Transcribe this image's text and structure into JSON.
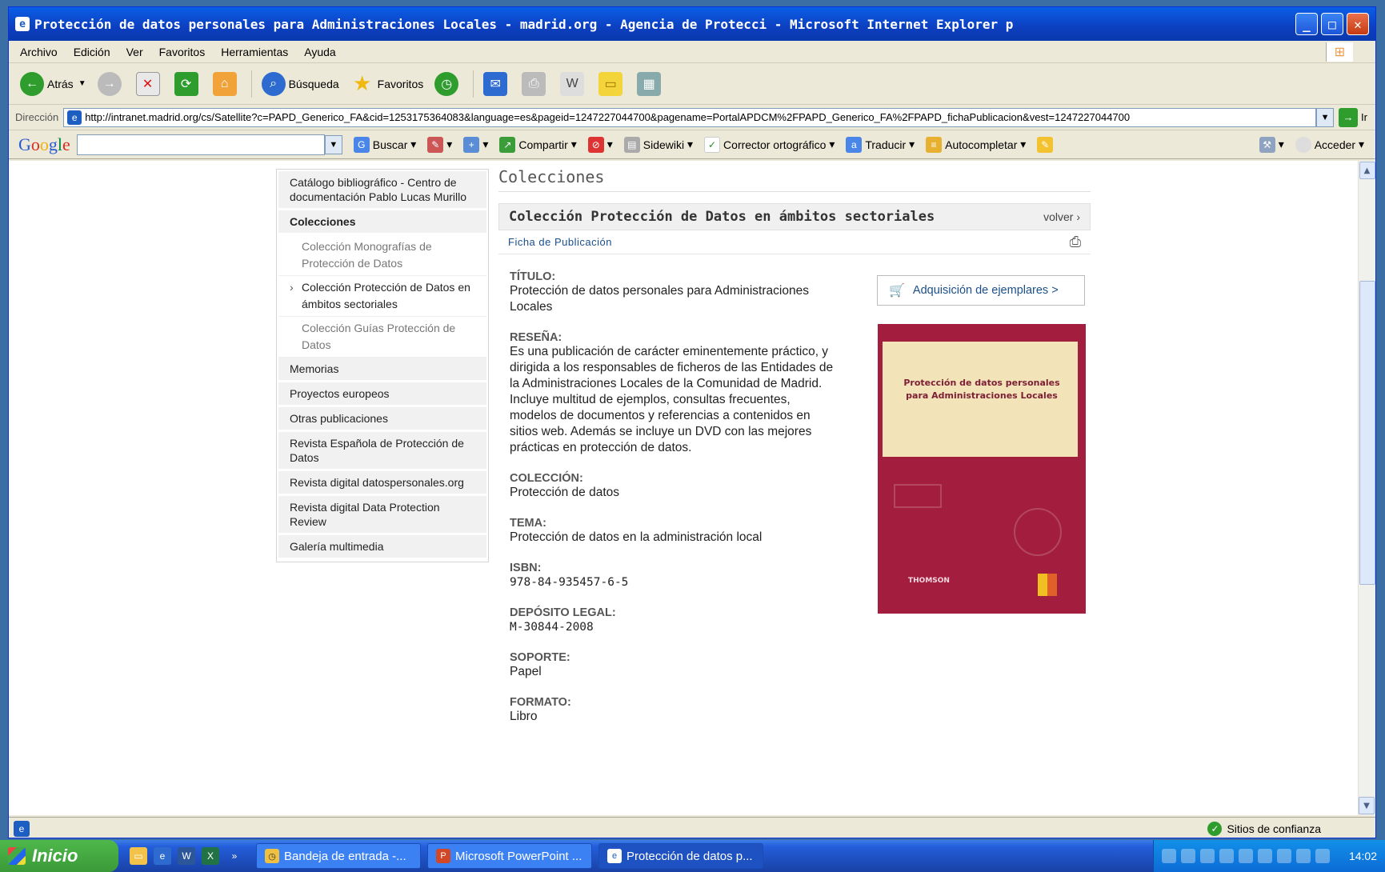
{
  "window": {
    "title": "Protección de datos personales para Administraciones Locales - madrid.org - Agencia de Protecci - Microsoft Internet Explorer p"
  },
  "menubar": [
    "Archivo",
    "Edición",
    "Ver",
    "Favoritos",
    "Herramientas",
    "Ayuda"
  ],
  "toolbar": {
    "back": "Atrás",
    "search": "Búsqueda",
    "favorites": "Favoritos"
  },
  "address": {
    "label": "Dirección",
    "url": "http://intranet.madrid.org/cs/Satellite?c=PAPD_Generico_FA&cid=1253175364083&language=es&pageid=1247227044700&pagename=PortalAPDCM%2FPAPD_Generico_FA%2FPAPD_fichaPublicacion&vest=1247227044700",
    "go": "Ir"
  },
  "googlebar": {
    "buscar": "Buscar",
    "compartir": "Compartir",
    "sidewiki": "Sidewiki",
    "corrector": "Corrector ortográfico",
    "traducir": "Traducir",
    "autocompletar": "Autocompletar",
    "acceder": "Acceder"
  },
  "sidebar": {
    "catalogo": "Catálogo bibliográfico - Centro de documentación Pablo Lucas Murillo",
    "colecciones": "Colecciones",
    "sub": [
      "Colección Monografías de Protección de Datos",
      "Colección Protección de Datos en ámbitos sectoriales",
      "Colección Guías Protección de Datos"
    ],
    "items": [
      "Memorias",
      "Proyectos europeos",
      "Otras publicaciones",
      "Revista Española de Protección de Datos",
      "Revista digital datospersonales.org",
      "Revista digital Data Protection Review",
      "Galería multimedia"
    ]
  },
  "main": {
    "page_title": "Colecciones",
    "collection": "Colección Protección de Datos en ámbitos sectoriales",
    "volver": "volver ›",
    "ficha": "Ficha de Publicación",
    "adquisicion": "Adquisición de ejemplares >",
    "fields": {
      "titulo_k": "TÍTULO:",
      "titulo_v": "Protección de datos personales para Administraciones Locales",
      "resena_k": "RESEÑA:",
      "resena_v": "Es una publicación de carácter eminentemente práctico, y dirigida a los responsables de ficheros de las Entidades de la Administraciones Locales de la Comunidad de Madrid. Incluye multitud de ejemplos, consultas frecuentes, modelos de documentos y referencias a contenidos en sitios web. Además se incluye un DVD con las mejores prácticas en protección de datos.",
      "coleccion_k": "COLECCIÓN:",
      "coleccion_v": "Protección de datos",
      "tema_k": "TEMA:",
      "tema_v": "Protección de datos en la administración local",
      "isbn_k": "ISBN:",
      "isbn_v": "978-84-935457-6-5",
      "deposito_k": "DEPÓSITO LEGAL:",
      "deposito_v": "M-30844-2008",
      "soporte_k": "SOPORTE:",
      "soporte_v": "Papel",
      "formato_k": "FORMATO:",
      "formato_v": "Libro"
    },
    "book": {
      "title_line1": "Protección de datos personales",
      "title_line2": "para Administraciones Locales",
      "publisher": "THOMSON"
    }
  },
  "status": {
    "zone": "Sitios de confianza"
  },
  "taskbar": {
    "start": "Inicio",
    "tasks": [
      "Bandeja de entrada -...",
      "Microsoft PowerPoint ...",
      "Protección de datos p..."
    ],
    "clock": "14:02"
  }
}
